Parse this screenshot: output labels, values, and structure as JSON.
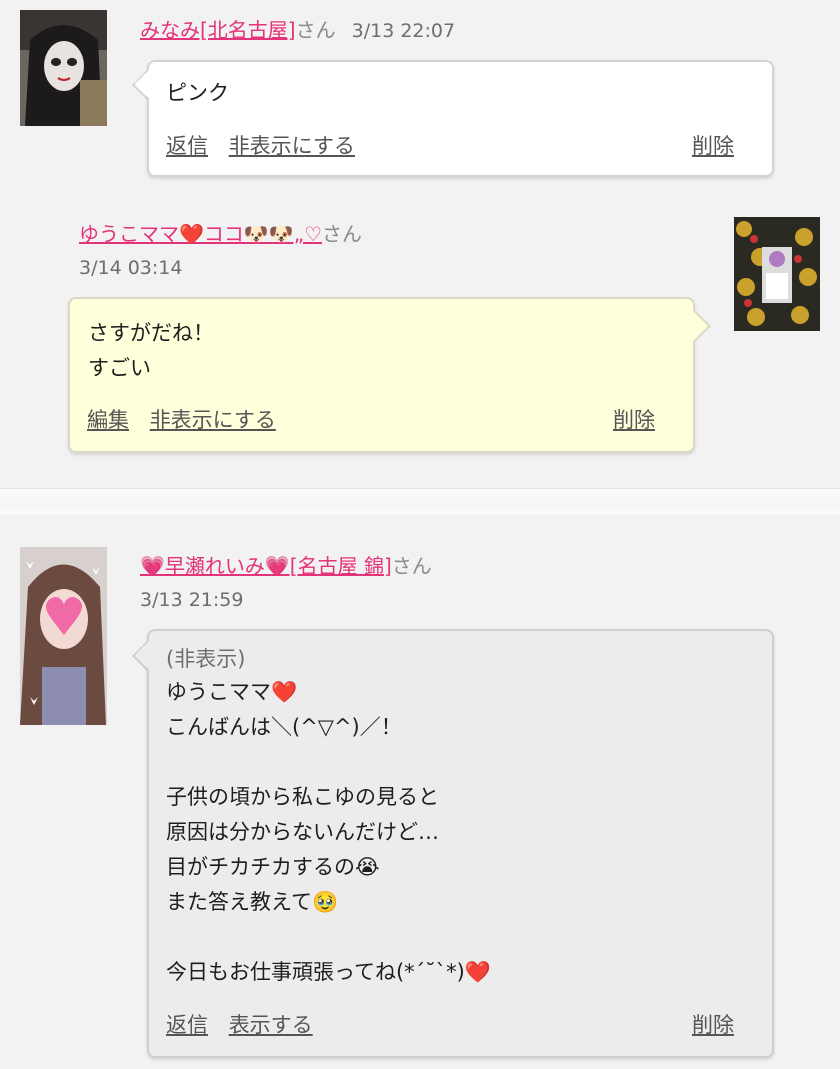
{
  "comments": [
    {
      "name": "みなみ[北名古屋]",
      "san": "さん",
      "date": "3/13 22:07",
      "message": "ピンク",
      "actions": [
        "返信",
        "非表示にする"
      ],
      "delete_label": "削除"
    },
    {
      "name": "ゆうこママ❤️ココ🐶🐶„♡",
      "san": "さん",
      "date": "3/14 03:14",
      "message": "さすがだね！\nすごい",
      "actions": [
        "編集",
        "非表示にする"
      ],
      "delete_label": "削除"
    },
    {
      "name": "💗早瀬れいみ💗[名古屋 錦]",
      "san": "さん",
      "date": "3/13 21:59",
      "hidden_label": "(非表示)",
      "message": "ゆうこママ❤️\nこんばんは＼(^▽^)／！\n\n子供の頃から私こゆの見ると\n原因は分からないんだけど…\n目がチカチカするの😭\nまた答え教えて🥹\n\n今日もお仕事頑張ってね(*´˘`*)❤️",
      "actions": [
        "返信",
        "表示する"
      ],
      "delete_label": "削除"
    }
  ],
  "colors": {
    "name_link": "#e3337a",
    "background": "#f3f2f2",
    "own_bubble": "#ffffdc",
    "hidden_bubble": "#ececec"
  }
}
